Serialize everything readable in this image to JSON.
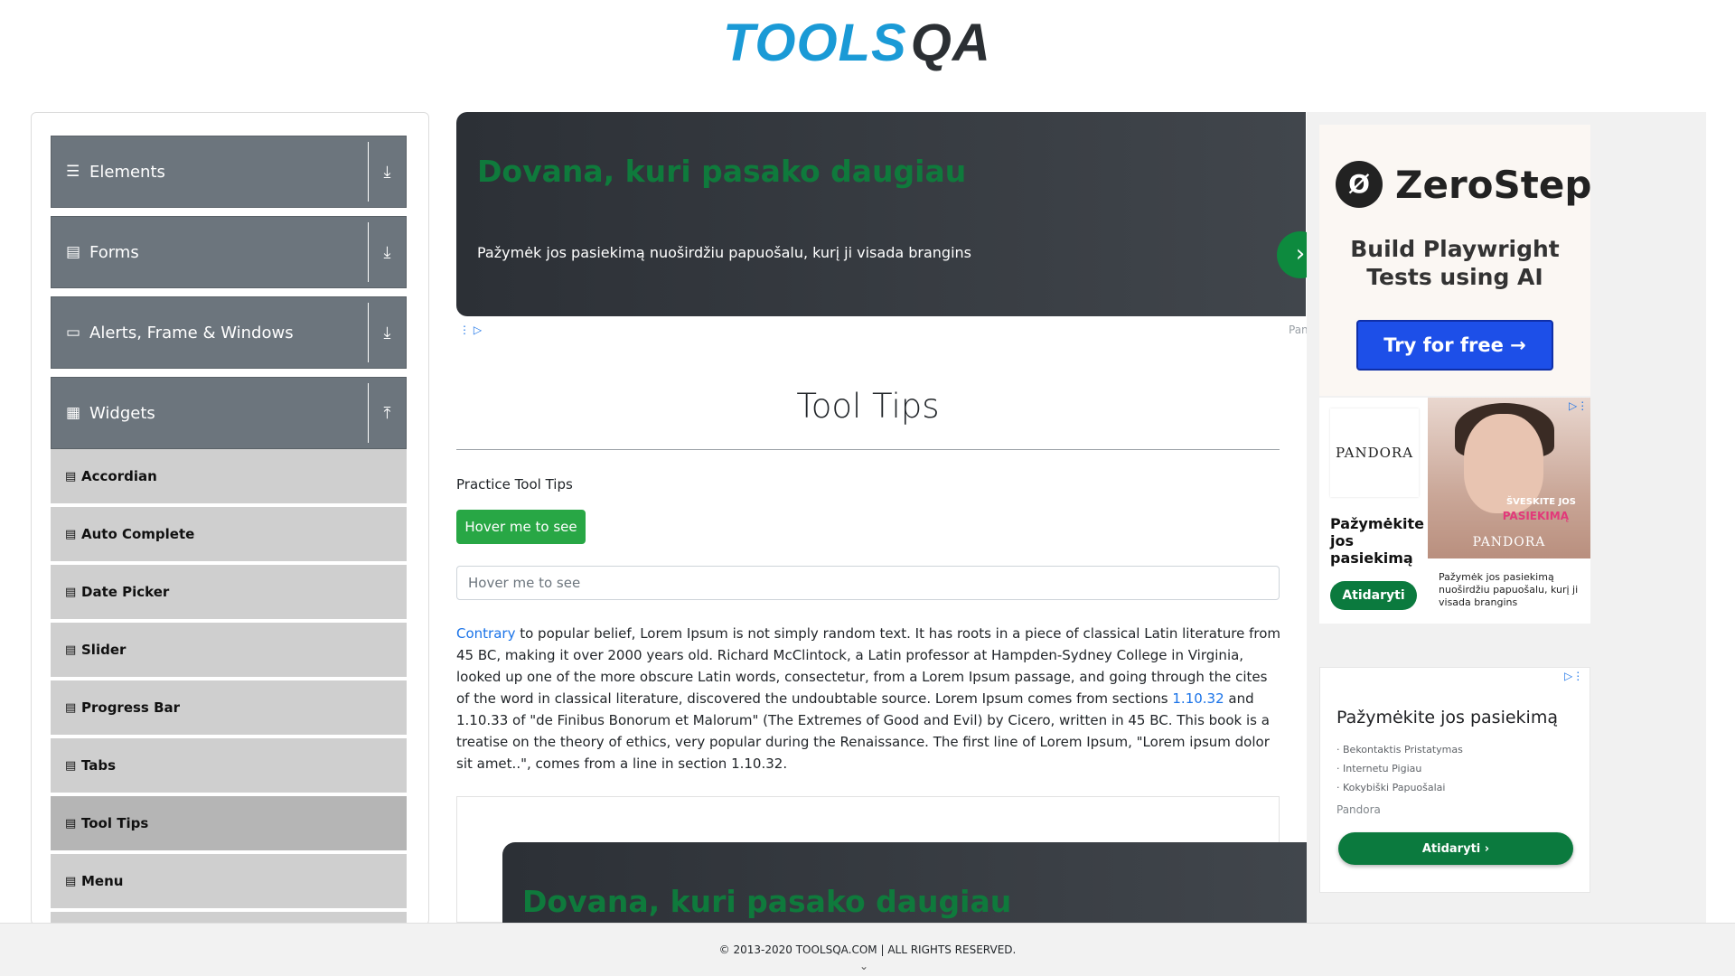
{
  "header": {
    "logo_tools": "TOOLS",
    "logo_qa": "QA"
  },
  "sidebar": {
    "groups": [
      {
        "label": "Elements",
        "icon": "menu-icon",
        "toggle": "download-icon"
      },
      {
        "label": "Forms",
        "icon": "document-icon",
        "toggle": "download-icon"
      },
      {
        "label": "Alerts, Frame & Windows",
        "icon": "window-icon",
        "toggle": "download-icon"
      },
      {
        "label": "Widgets",
        "icon": "grid-icon",
        "toggle": "upload-icon"
      }
    ],
    "items": [
      {
        "label": "Accordian"
      },
      {
        "label": "Auto Complete"
      },
      {
        "label": "Date Picker"
      },
      {
        "label": "Slider"
      },
      {
        "label": "Progress Bar"
      },
      {
        "label": "Tabs"
      },
      {
        "label": "Tool Tips",
        "active": true
      },
      {
        "label": "Menu"
      }
    ]
  },
  "top_ad": {
    "title": "Dovana, kuri pasako daugiau",
    "text": "Pažymėk jos pasiekimą nuoširdžiu papuošalu, kurį ji visada brangins",
    "side_label": "Pan"
  },
  "main": {
    "title": "Tool Tips",
    "practice_label": "Practice Tool Tips",
    "hover_button": "Hover me to see",
    "hover_input_placeholder": "Hover me to see",
    "paragraph": {
      "link1": "Contrary",
      "text1": " to popular belief, Lorem Ipsum is not simply random text. It has roots in a piece of classical Latin literature from 45 BC, making it over 2000 years old. Richard McClintock, a Latin professor at Hampden-Sydney College in Virginia, looked up one of the more obscure Latin words, consectetur, from a Lorem Ipsum passage, and going through the cites of the word in classical literature, discovered the undoubtable source. Lorem Ipsum comes from sections ",
      "link2": "1.10.32",
      "text2": " and 1.10.33 of \"de Finibus Bonorum et Malorum\" (The Extremes of Good and Evil) by Cicero, written in 45 BC. This book is a treatise on the theory of ethics, very popular during the Renaissance. The first line of Lorem Ipsum, \"Lorem ipsum dolor sit amet..\", comes from a line in section 1.10.32."
    }
  },
  "lower_ad": {
    "title": "Dovana, kuri pasako daugiau"
  },
  "right_ads": {
    "zerostep": {
      "brand": "ZeroStep",
      "tagline_1": "Build Playwright",
      "tagline_2": "Tests using AI",
      "button": "Try for free →"
    },
    "pandora": {
      "logo": "PANDORA",
      "headline": "Pažymėkite jos pasiekimą",
      "button": "Atidaryti",
      "photo_text_1": "ŠVESKITE JOS",
      "photo_text_2": "PASIEKIMĄ",
      "photo_brand": "PANDORA",
      "caption": "Pažymėk jos pasiekimą nuoširdžiu papuošalu, kurį ji visada brangins"
    },
    "pandora2": {
      "title": "Pažymėkite jos pasiekimą",
      "bullets": [
        "Bekontaktis Pristatymas",
        "Internetu Pigiau",
        "Kokybiški Papuošalai"
      ],
      "brand": "Pandora",
      "button": "Atidaryti ›"
    }
  },
  "footer": {
    "text": "© 2013-2020 TOOLSQA.COM | ALL RIGHTS RESERVED."
  },
  "colors": {
    "accent_green": "#28a745",
    "sidebar_group": "#6c757d",
    "ad_green": "#0f7a3c",
    "link_blue": "#1a73e8",
    "logo_blue": "#1a9ad6"
  }
}
